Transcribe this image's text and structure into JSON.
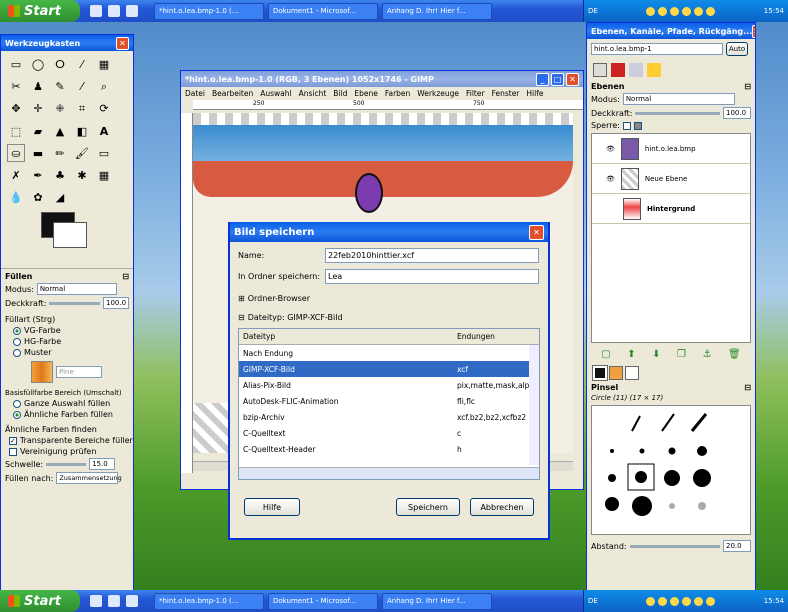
{
  "taskbar": {
    "start": "Start",
    "buttons": [
      "*hint.o.lea.bmp-1.0 (...",
      "Dokument1 - Microsof...",
      "Anhang D. Ihr! Hier f..."
    ],
    "lang": "DE",
    "clock": "15:54"
  },
  "toolbox": {
    "title": "Werkzeugkasten",
    "section": "Füllen",
    "mode_label": "Modus:",
    "mode_value": "Normal",
    "opacity_label": "Deckkraft:",
    "opacity_value": "100.0",
    "filltype_label": "Füllart (Strg)",
    "filltypes": [
      "VG-Farbe",
      "HG-Farbe",
      "Muster"
    ],
    "pattern_name": "Pine",
    "area_label": "Basisfüllfarbe Bereich (Umschalt)",
    "areas": [
      "Ganze Auswahl füllen",
      "Ähnliche Farben füllen"
    ],
    "similar_label": "Ähnliche Farben finden",
    "similar_opts": [
      "Transparente Bereiche füllen",
      "Vereinigung prüfen"
    ],
    "threshold_label": "Schwelle:",
    "threshold_value": "15.0",
    "fillby_label": "Füllen nach:",
    "fillby_value": "Zusammensetzung"
  },
  "gimp": {
    "title": "*hint.o.lea.bmp-1.0 (RGB, 3 Ebenen) 1052x1746 - GIMP",
    "menu": [
      "Datei",
      "Bearbeiten",
      "Auswahl",
      "Ansicht",
      "Bild",
      "Ebene",
      "Farben",
      "Werkzeuge",
      "Filter",
      "Fenster",
      "Hilfe"
    ],
    "ruler": [
      "250",
      "500",
      "750"
    ]
  },
  "dialog": {
    "title": "Bild speichern",
    "name_label": "Name:",
    "name_value": "22feb2010hinttier.xcf",
    "folder_label": "In Ordner speichern:",
    "folder_value": "Lea",
    "browser_label": "Ordner-Browser",
    "filetype_label": "Dateityp: GIMP-XCF-Bild",
    "col_type": "Dateityp",
    "col_ext": "Endungen",
    "rows": [
      {
        "t": "Nach Endung",
        "e": ""
      },
      {
        "t": "GIMP-XCF-Bild",
        "e": "xcf"
      },
      {
        "t": "Alias-Pix-Bild",
        "e": "pix,matte,mask,alp"
      },
      {
        "t": "AutoDesk-FLIC-Animation",
        "e": "fli,flc"
      },
      {
        "t": "bzip-Archiv",
        "e": "xcf.bz2,bz2,xcfbz2"
      },
      {
        "t": "C-Quelltext",
        "e": "c"
      },
      {
        "t": "C-Quelltext-Header",
        "e": "h"
      }
    ],
    "help": "Hilfe",
    "save": "Speichern",
    "cancel": "Abbrechen"
  },
  "layers": {
    "title": "Ebenen, Kanäle, Pfade, Rückgäng...",
    "image": "hint.o.lea.bmp-1",
    "auto": "Auto",
    "section": "Ebenen",
    "mode_label": "Modus:",
    "mode_value": "Normal",
    "opacity_label": "Deckkraft:",
    "opacity_value": "100.0",
    "lock_label": "Sperre:",
    "items": [
      "hint.o.lea.bmp",
      "Neue Ebene",
      "Hintergrund"
    ],
    "brush_section": "Pinsel",
    "brush_name": "Circle (11) (17 × 17)",
    "spacing_label": "Abstand:",
    "spacing_value": "20.0"
  }
}
